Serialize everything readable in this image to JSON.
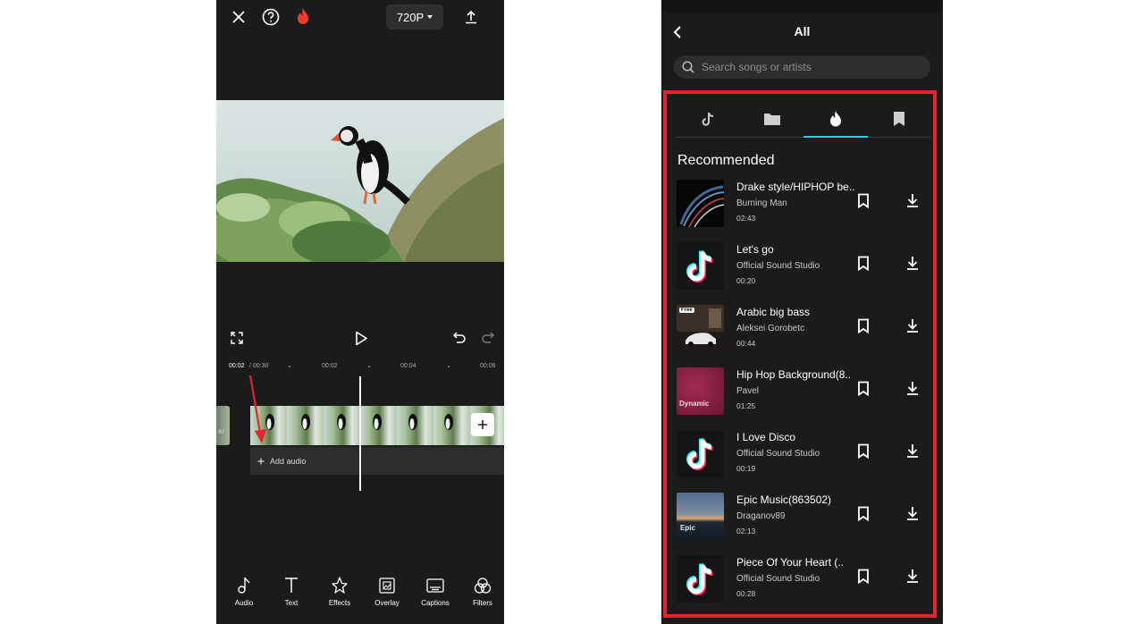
{
  "editor": {
    "resolution": "720P",
    "timecode_current": "00:02",
    "timecode_total": "/ 00:30",
    "ruler_marks": [
      "00:02",
      "00:04",
      "00:06"
    ],
    "add_audio_label": "Add audio",
    "prev_clip_fragment": "er",
    "tools": [
      {
        "label": "Audio",
        "icon": "music-note-icon"
      },
      {
        "label": "Text",
        "icon": "text-icon"
      },
      {
        "label": "Effects",
        "icon": "effects-star-icon"
      },
      {
        "label": "Overlay",
        "icon": "overlay-icon"
      },
      {
        "label": "Captions",
        "icon": "captions-icon"
      },
      {
        "label": "Filters",
        "icon": "filters-icon"
      }
    ]
  },
  "library": {
    "title": "All",
    "search_placeholder": "Search songs or artists",
    "tabs": [
      "tiktok-icon",
      "folder-icon",
      "flame-icon",
      "bookmark-icon"
    ],
    "active_tab": 2,
    "section_title": "Recommended",
    "songs": [
      {
        "title": "Drake style/HIPHOP be..",
        "artist": "Burning Man",
        "duration": "02:43",
        "thumb": "abstract"
      },
      {
        "title": "Let's go",
        "artist": "Official Sound Studio",
        "duration": "00:20",
        "thumb": "tiktok"
      },
      {
        "title": "Arabic big bass",
        "artist": "Aleksei Gorobetc",
        "duration": "00:44",
        "thumb": "car",
        "badge": "Free"
      },
      {
        "title": "Hip Hop Background(8..",
        "artist": "Pavel",
        "duration": "01:25",
        "thumb": "dynamic",
        "thumb_text": "Dynamic"
      },
      {
        "title": "I Love Disco",
        "artist": "Official Sound Studio",
        "duration": "00:19",
        "thumb": "tiktok"
      },
      {
        "title": "Epic Music(863502)",
        "artist": "Draganov89",
        "duration": "02:13",
        "thumb": "epic",
        "thumb_text": "Epic"
      },
      {
        "title": "Piece Of Your Heart (..",
        "artist": "Official Sound Studio",
        "duration": "00:28",
        "thumb": "tiktok"
      }
    ]
  },
  "colors": {
    "accent_red": "#e5252d",
    "tab_underline": "#3ec7d6",
    "background": "#1b1b1b"
  }
}
